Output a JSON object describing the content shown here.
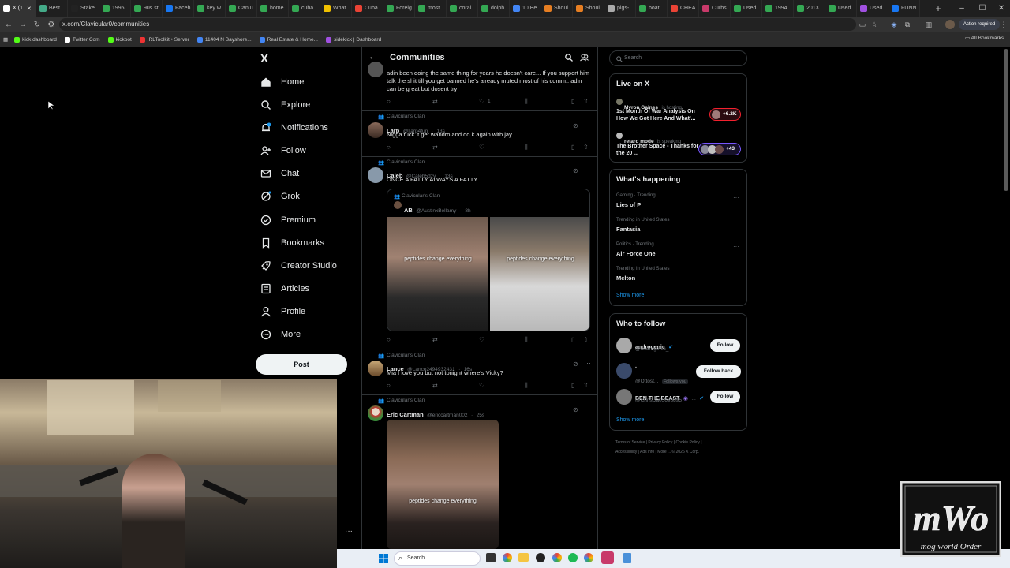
{
  "browser": {
    "tabs": [
      "X (1",
      "Best",
      "Stake",
      "1995",
      "90s st",
      "Faceb",
      "key w",
      "Can u",
      "home",
      "cuba",
      "What",
      "Cuba",
      "Foreig",
      "most",
      "coral",
      "dolph",
      "10 Be",
      "Shoul",
      "Shoul",
      "pigs-",
      "boat",
      "CHEA",
      "Curbs",
      "Used",
      "1994",
      "2013",
      "Used",
      "Used",
      "FUNN"
    ],
    "url": "x.com/Clavicular0/communities",
    "action_required": "Action required",
    "bookmarks": [
      "kick dashboard",
      "Twitter Com",
      "kickbot",
      "IRLToolkit • Server",
      "11404 N Bayshore...",
      "Real Estate & Home...",
      "sidekick | Dashboard"
    ],
    "all_bookmarks": "All Bookmarks"
  },
  "nav": {
    "logo": "X",
    "items": [
      {
        "label": "Home",
        "icon": "home-icon"
      },
      {
        "label": "Explore",
        "icon": "search-icon"
      },
      {
        "label": "Notifications",
        "icon": "bell-icon"
      },
      {
        "label": "Follow",
        "icon": "person-add-icon"
      },
      {
        "label": "Chat",
        "icon": "mail-icon"
      },
      {
        "label": "Grok",
        "icon": "grok-icon"
      },
      {
        "label": "Premium",
        "icon": "verified-icon"
      },
      {
        "label": "Bookmarks",
        "icon": "bookmark-icon"
      },
      {
        "label": "Creator Studio",
        "icon": "rocket-icon"
      },
      {
        "label": "Articles",
        "icon": "article-icon"
      },
      {
        "label": "Profile",
        "icon": "profile-icon"
      },
      {
        "label": "More",
        "icon": "more-circle-icon"
      }
    ],
    "post": "Post"
  },
  "timeline": {
    "title": "Communities",
    "tweets": [
      {
        "text": "adin been doing the same thing for years he doesn't care... If you support him talk the shit till you get banned he's already muted most of his comm.. adin can be great but dosent try",
        "likes": "1"
      },
      {
        "community": "Clavicular's Clan",
        "name": "Larp",
        "handle": "@llarp4fun",
        "time": "13s",
        "text": "Nigga fuck it get wandro and do k again with jay"
      },
      {
        "community": "Clavicular's Clan",
        "name": "Caleb",
        "handle": "@Caleb5dzy",
        "time": "13s",
        "text": "ONCE A FATTY ALWAYS A FATTY",
        "quote": {
          "community": "Clavicular's Clan",
          "name": "AB",
          "handle": "@AustinxBellamy",
          "time": "8h",
          "caption1": "peptides change everything",
          "caption2": "peptides change everything"
        }
      },
      {
        "community": "Clavicular's Clan",
        "name": "Lance",
        "handle": "@Lance2494932431",
        "time": "16s",
        "text": "Mia I love you but not tonight where's Vicky?"
      },
      {
        "community": "Clavicular's Clan",
        "name": "Eric Cartman",
        "handle": "@ericcartman002",
        "time": "25s",
        "caption": "peptides change everything"
      }
    ]
  },
  "right": {
    "search_placeholder": "Search",
    "live": {
      "title": "Live on X",
      "items": [
        {
          "host": "Myron Gaines",
          "status": "is hosting",
          "title": "1st Month Of War Analysis On How We Got Here And What'...",
          "count": "+6.2K"
        },
        {
          "host": "retard mode",
          "status": "is speaking",
          "title": "The Brother Space - Thanks for the 20 ...",
          "count": "+43"
        }
      ]
    },
    "happening": {
      "title": "What's happening",
      "items": [
        {
          "context": "Gaming · Trending",
          "topic": "Lies of P"
        },
        {
          "context": "Trending in United States",
          "topic": "Fantasia"
        },
        {
          "context": "Politics · Trending",
          "topic": "Air Force One"
        },
        {
          "context": "Trending in United States",
          "topic": "Melton"
        }
      ],
      "show_more": "Show more"
    },
    "who_to_follow": {
      "title": "Who to follow",
      "items": [
        {
          "name": "androgenic",
          "handle": "@androgenic_",
          "button": "Follow"
        },
        {
          "name": ".",
          "handle": "@Ottost...",
          "badge": "Follows you",
          "button": "Follow back"
        },
        {
          "name": "BEN THE BEAST",
          "handle": "@ChrisDa05695895",
          "button": "Follow"
        }
      ],
      "show_more": "Show more"
    },
    "footer": [
      "Terms of Service",
      "Privacy Policy",
      "Cookie Policy",
      "Accessibility",
      "Ads info",
      "More ...",
      "© 2026 X Corp."
    ]
  },
  "taskbar": {
    "search": "Search"
  },
  "watermark": "mog world Order"
}
